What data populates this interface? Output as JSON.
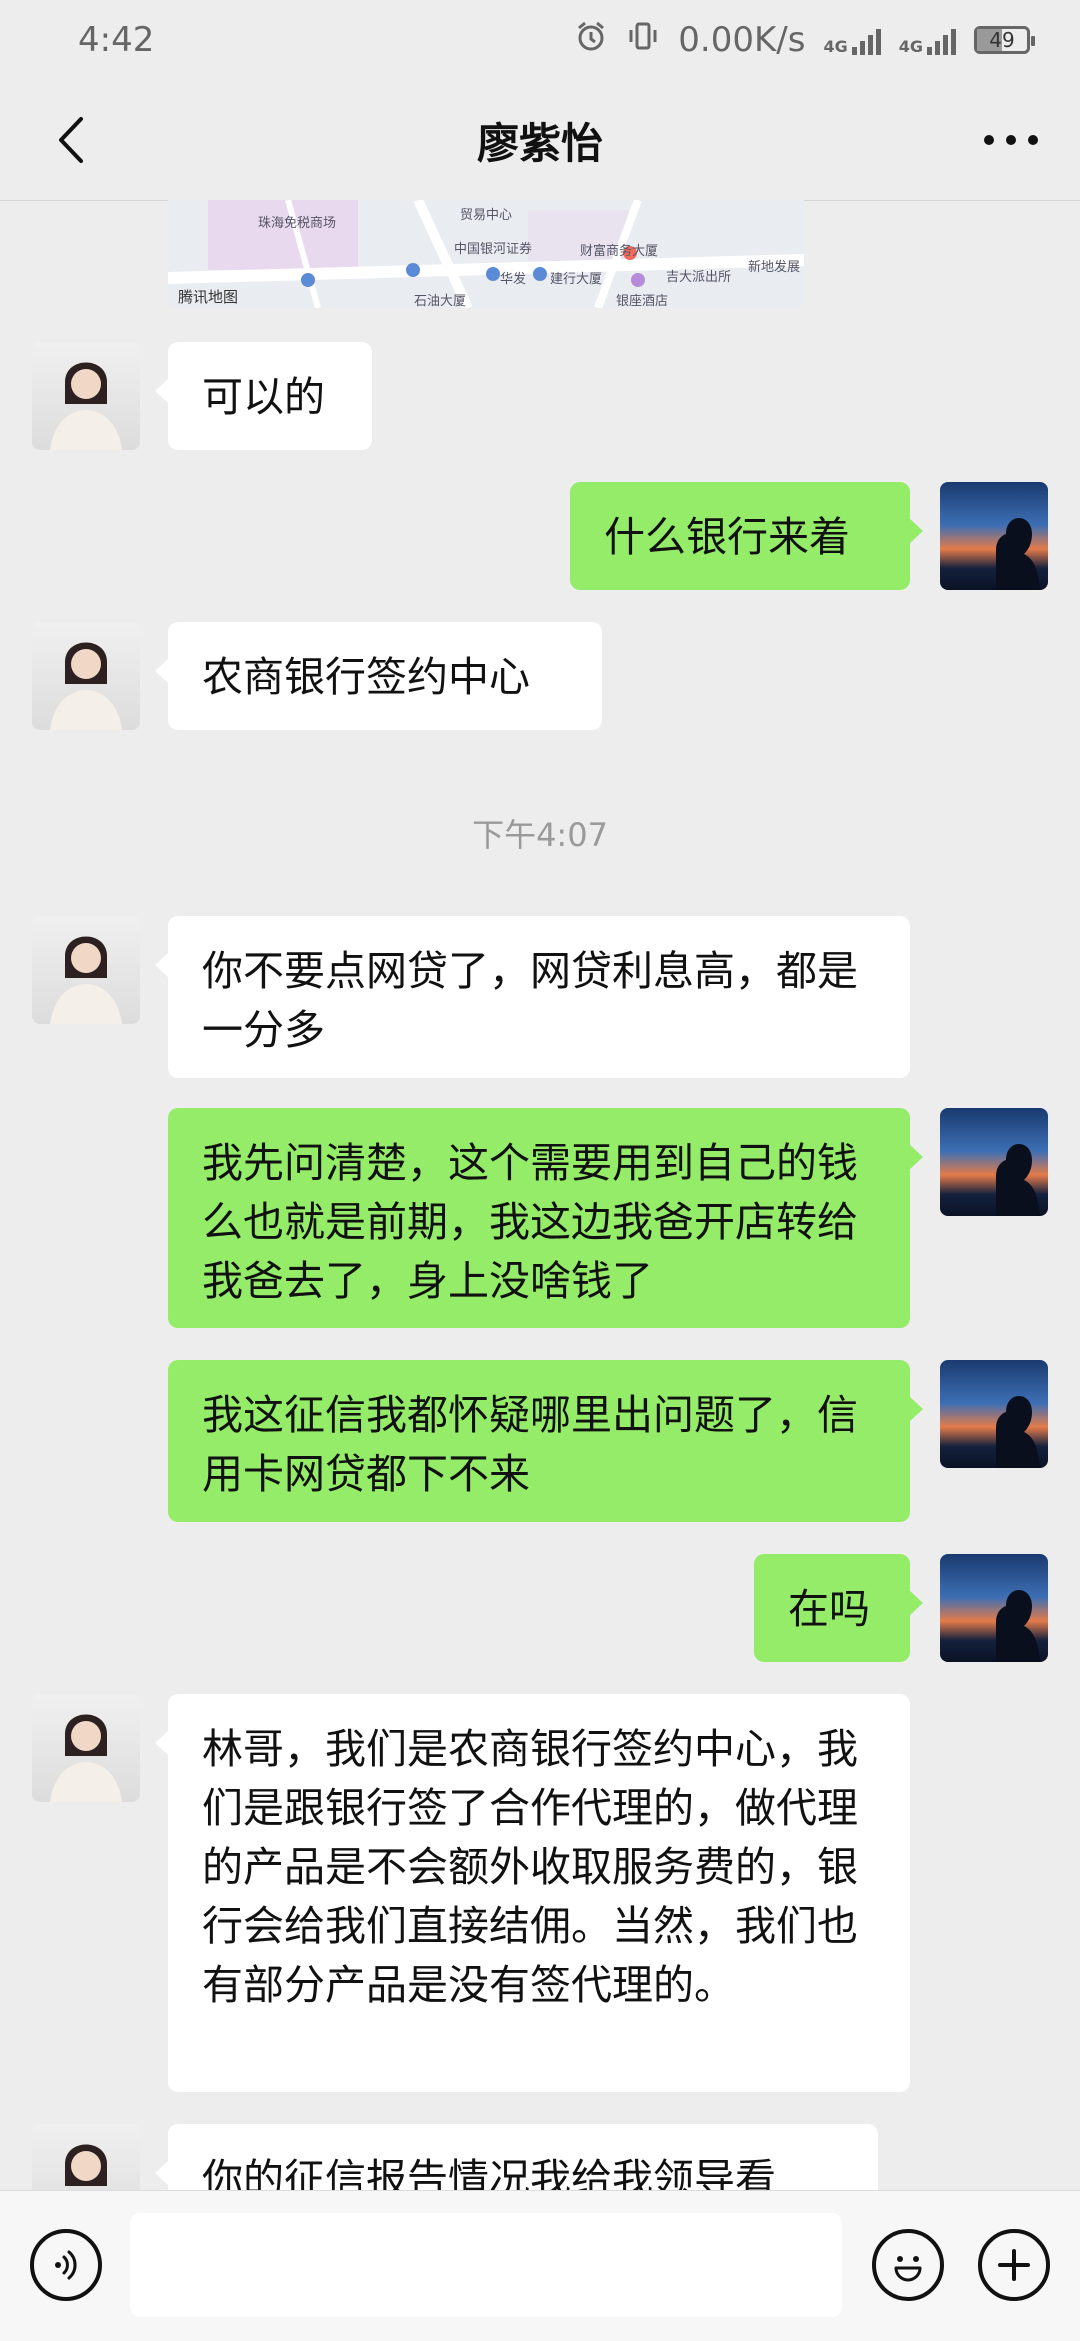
{
  "status": {
    "time": "4:42",
    "speed": "0.00K/s",
    "net1": "4G",
    "net2": "4G",
    "battery": "49",
    "battery_level": 0.49
  },
  "header": {
    "title": "廖紫怡",
    "back_icon": "chevron-left-icon",
    "more_icon": "more-dots-icon"
  },
  "map": {
    "labels": [
      "珠海免税商场",
      "贸易中心",
      "中国银河证券",
      "财富商务大厦",
      "华发",
      "建行大厦",
      "石油大厦",
      "银座酒店",
      "新地发展",
      "吉大派出所"
    ],
    "brand": "腾讯地图"
  },
  "messages": [
    {
      "side": "in",
      "text": "可以的"
    },
    {
      "side": "out",
      "text": "什么银行来着"
    },
    {
      "side": "in",
      "text": "农商银行签约中心"
    },
    {
      "timestamp": "下午4:07"
    },
    {
      "side": "in",
      "text": "你不要点网贷了，网贷利息高，都是一分多"
    },
    {
      "side": "out",
      "text": "我先问清楚，这个需要用到自己的钱么也就是前期，我这边我爸开店转给我爸去了，身上没啥钱了"
    },
    {
      "side": "out",
      "text": "我这征信我都怀疑哪里出问题了，信用卡网贷都下不来"
    },
    {
      "side": "out",
      "text": "在吗"
    },
    {
      "side": "in",
      "text": "林哥，我们是农商银行签约中心，我们是跟银行签了合作代理的，做代理的产品是不会额外收取服务费的，银行会给我们直接结佣。当然，我们也有部分产品是没有签代理的。"
    },
    {
      "side": "in",
      "text": "你的征信报告情况我给我领导看"
    }
  ],
  "input": {
    "voice_icon": "voice-icon",
    "emoji_icon": "emoji-icon",
    "plus_icon": "plus-icon",
    "value": ""
  },
  "colors": {
    "background": "#ededed",
    "bubble_out": "#95ec69",
    "bubble_in": "#ffffff"
  }
}
